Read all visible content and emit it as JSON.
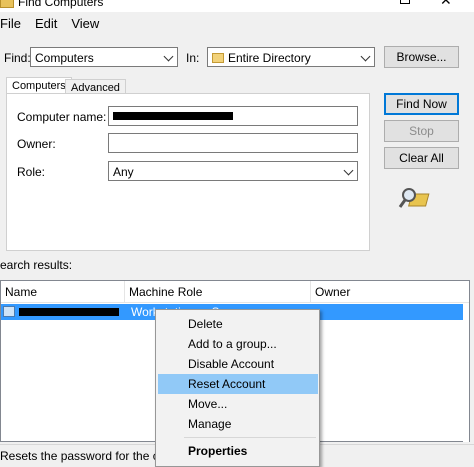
{
  "window": {
    "title": "Find Computers",
    "close_glyph": "✕"
  },
  "menu": [
    "File",
    "Edit",
    "View"
  ],
  "find": {
    "label": "Find:",
    "value": "Computers"
  },
  "in": {
    "label": "In:",
    "value": "Entire Directory"
  },
  "buttons": {
    "browse": "Browse...",
    "find_now": "Find Now",
    "stop": "Stop",
    "clear_all": "Clear All"
  },
  "tabs": [
    "Computers",
    "Advanced"
  ],
  "form": {
    "computer_name_label": "Computer name:",
    "owner_label": "Owner:",
    "owner_value": "",
    "role_label": "Role:",
    "role_value": "Any"
  },
  "results": {
    "label": "earch results:",
    "columns": [
      "Name",
      "Machine Role",
      "Owner"
    ],
    "selected_row_role": "Workstation or Server"
  },
  "context_menu": [
    "Delete",
    "Add to a group...",
    "Disable Account",
    "Reset Account",
    "Move...",
    "Manage",
    "Properties"
  ],
  "status": "Resets the password for the current selection."
}
